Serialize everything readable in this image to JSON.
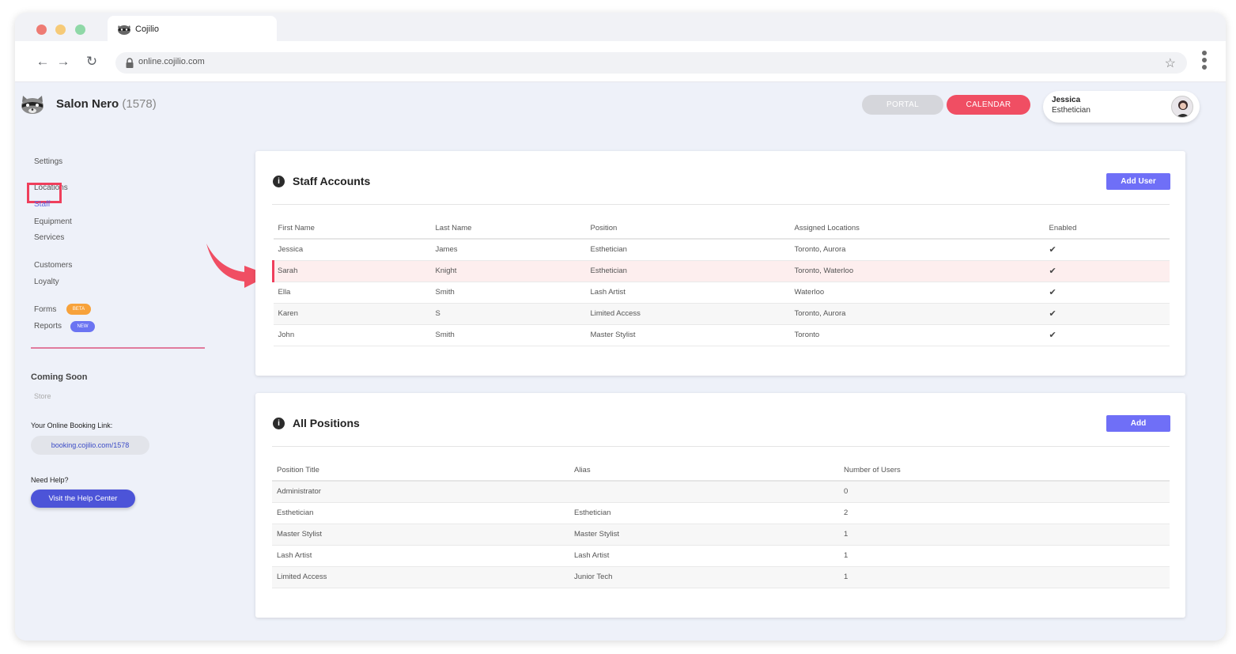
{
  "browser": {
    "tab_title": "Cojilio",
    "url": "online.cojilio.com"
  },
  "header": {
    "salon_name": "Salon Nero",
    "salon_id": "(1578)",
    "portal_label": "PORTAL",
    "calendar_label": "CALENDAR",
    "user_name": "Jessica",
    "user_role": "Esthetician"
  },
  "sidebar": {
    "settings": "Settings",
    "locations": "Locations",
    "staff": "Staff",
    "equipment": "Equipment",
    "services": "Services",
    "customers": "Customers",
    "loyalty": "Loyalty",
    "forms": "Forms",
    "forms_badge": "BETA",
    "reports": "Reports",
    "reports_badge": "NEW",
    "coming_soon": "Coming Soon",
    "store": "Store",
    "booking_label": "Your Online Booking Link:",
    "booking_link": "booking.cojilio.com/1578",
    "help_label": "Need Help?",
    "help_button": "Visit the Help Center"
  },
  "staff_accounts": {
    "title": "Staff Accounts",
    "add_button": "Add User",
    "columns": [
      "First Name",
      "Last Name",
      "Position",
      "Assigned Locations",
      "Enabled"
    ],
    "rows": [
      [
        "Jessica",
        "James",
        "Esthetician",
        "Toronto, Aurora",
        "✔"
      ],
      [
        "Sarah",
        "Knight",
        "Esthetician",
        "Toronto, Waterloo",
        "✔"
      ],
      [
        "Ella",
        "Smith",
        "Lash Artist",
        "Waterloo",
        "✔"
      ],
      [
        "Karen",
        "S",
        "Limited Access",
        "Toronto, Aurora",
        "✔"
      ],
      [
        "John",
        "Smith",
        "Master Stylist",
        "Toronto",
        "✔"
      ]
    ]
  },
  "all_positions": {
    "title": "All Positions",
    "add_button": "Add",
    "columns": [
      "Position Title",
      "Alias",
      "Number of Users"
    ],
    "rows": [
      [
        "Administrator",
        "",
        "0"
      ],
      [
        "Esthetician",
        "Esthetician",
        "2"
      ],
      [
        "Master Stylist",
        "Master Stylist",
        "1"
      ],
      [
        "Lash Artist",
        "Lash Artist",
        "1"
      ],
      [
        "Limited Access",
        "Junior Tech",
        "1"
      ]
    ]
  },
  "colors": {
    "accent": "#6f6ff7",
    "calendar": "#f04e63",
    "highlight": "#ef3f5c",
    "help_button": "#4c54d8"
  }
}
